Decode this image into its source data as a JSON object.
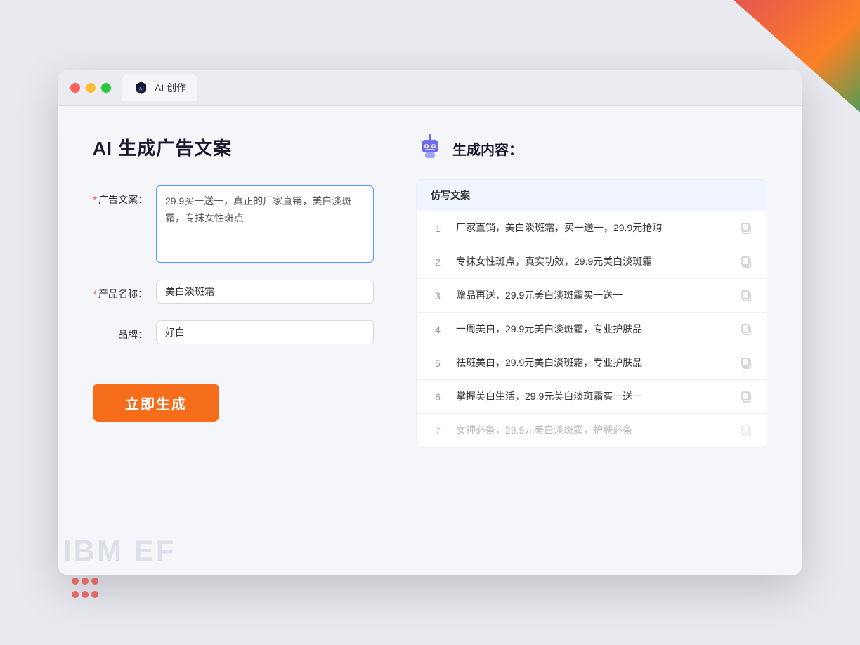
{
  "window": {
    "tab_label": "AI 创作"
  },
  "left": {
    "title": "AI 生成广告文案",
    "form": {
      "ad_copy_label": "广告文案：",
      "ad_copy_required": "*",
      "ad_copy_value": "29.9买一送一，真正的厂家直销，美白淡斑霜，专抹女性斑点",
      "product_name_label": "产品名称：",
      "product_name_required": "*",
      "product_name_value": "美白淡斑霜",
      "brand_label": "品牌：",
      "brand_value": "好白"
    },
    "generate_button": "立即生成"
  },
  "right": {
    "section_title": "生成内容：",
    "table_header": "仿写文案",
    "rows": [
      {
        "num": "1",
        "text": "厂家直销，美白淡斑霜，买一送一，29.9元抢购",
        "muted": false
      },
      {
        "num": "2",
        "text": "专抹女性斑点，真实功效，29.9元美白淡斑霜",
        "muted": false
      },
      {
        "num": "3",
        "text": "赠品再送，29.9元美白淡斑霜买一送一",
        "muted": false
      },
      {
        "num": "4",
        "text": "一周美白，29.9元美白淡斑霜，专业护肤品",
        "muted": false
      },
      {
        "num": "5",
        "text": "祛斑美白，29.9元美白淡斑霜，专业护肤品",
        "muted": false
      },
      {
        "num": "6",
        "text": "掌握美白生活，29.9元美白淡斑霜买一送一",
        "muted": false
      },
      {
        "num": "7",
        "text": "女神必备，29.9元美白淡斑霜，护肤必备",
        "muted": true
      }
    ]
  },
  "decorations": {
    "ibm_ef": "IBM EF"
  },
  "colors": {
    "accent_orange": "#f56c1a",
    "accent_blue": "#4b9eff"
  }
}
